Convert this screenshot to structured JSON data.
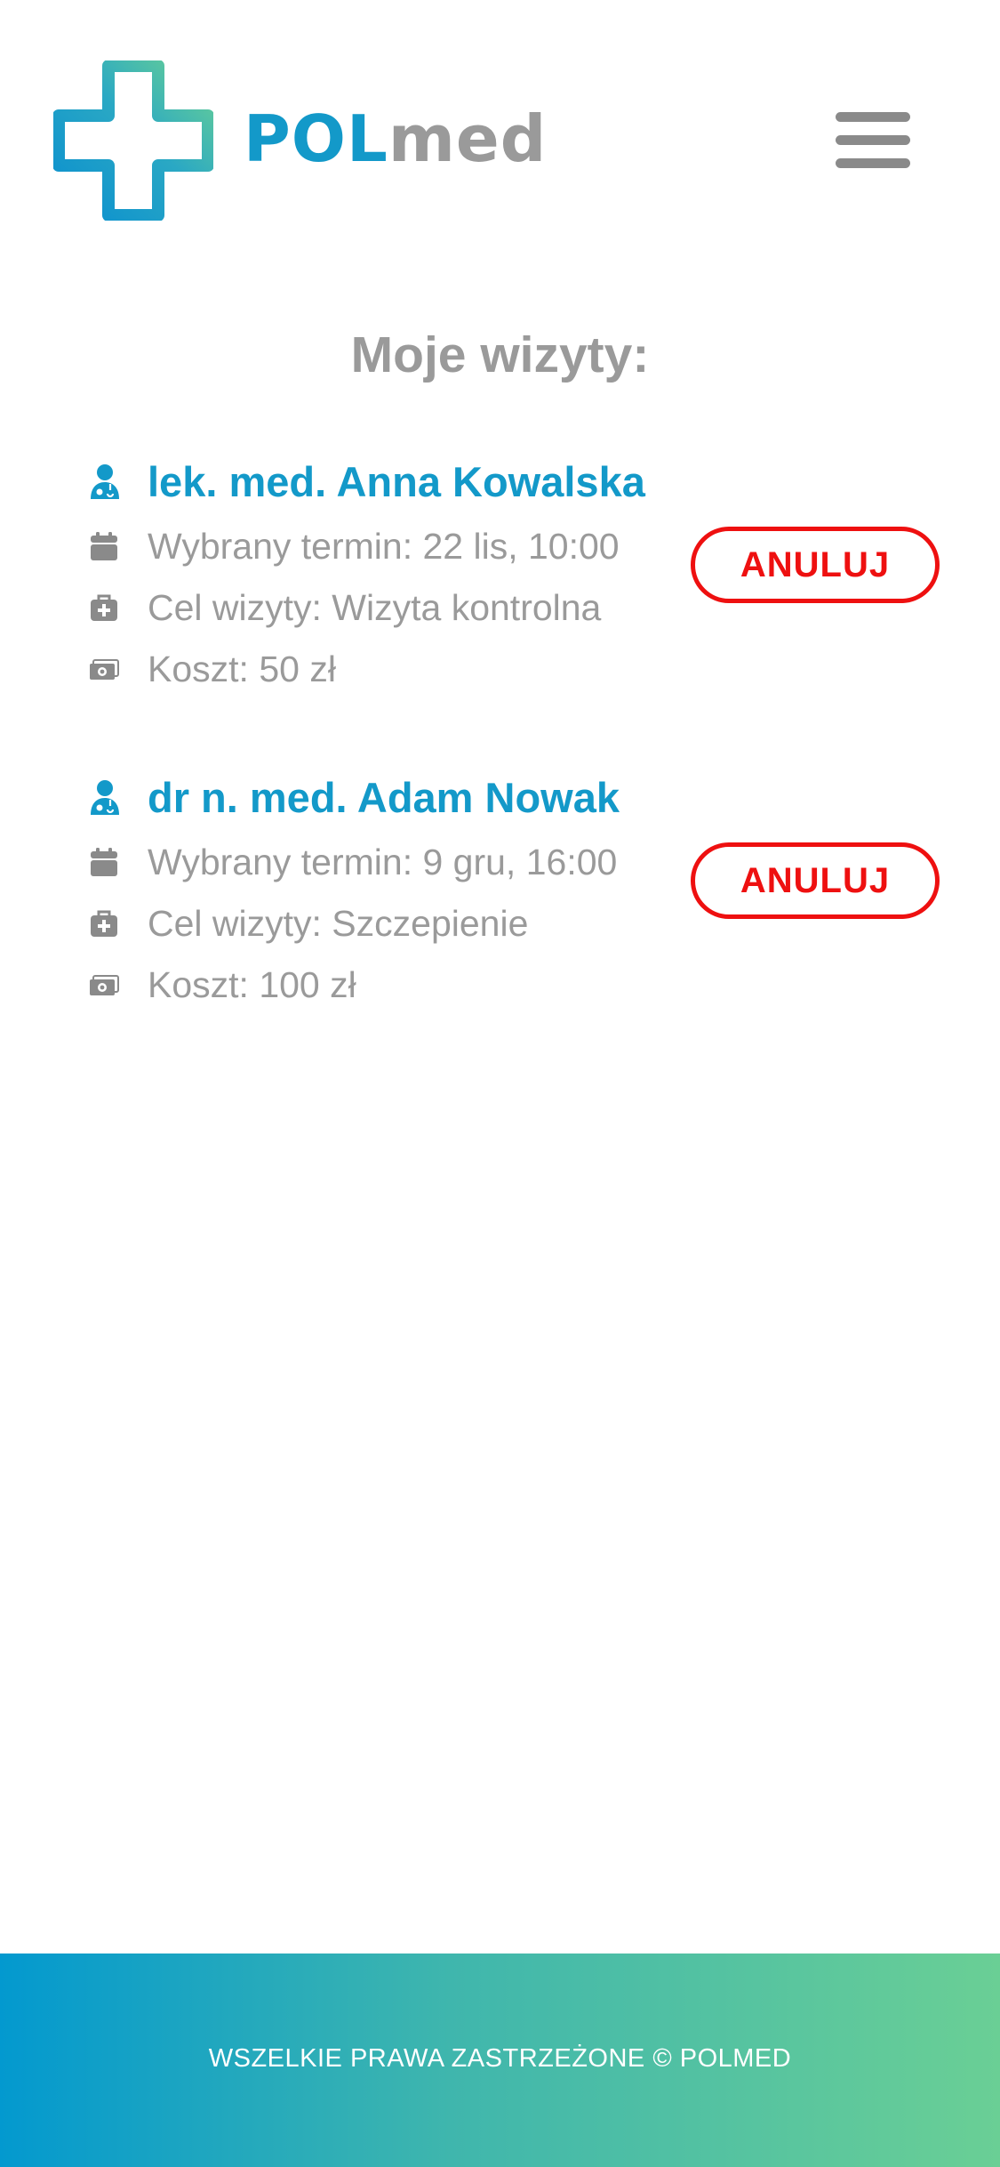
{
  "header": {
    "logo_pol": "POL",
    "logo_med": "med",
    "logo_icon": "medical-cross-logo",
    "menu_icon": "hamburger-menu-icon"
  },
  "page": {
    "title": "Moje wizyty:"
  },
  "visits": [
    {
      "doctor": "lek. med. Anna Kowalska",
      "date": "Wybrany termin: 22 lis, 10:00",
      "purpose": "Cel wizyty: Wizyta kontrolna",
      "cost": "Koszt: 50 zł",
      "cancel_label": "ANULUJ"
    },
    {
      "doctor": "dr n. med. Adam Nowak",
      "date": "Wybrany termin: 9 gru, 16:00",
      "purpose": "Cel wizyty: Szczepienie",
      "cost": "Koszt: 100 zł",
      "cancel_label": "ANULUJ"
    }
  ],
  "footer": {
    "text": "WSZELKIE PRAWA ZASTRZEŻONE © POLMED"
  },
  "colors": {
    "brand_blue": "#1399c9",
    "brand_green": "#6acf95",
    "text_gray": "#9a9a9a",
    "cancel_red": "#ee1010"
  },
  "icons": {
    "doctor": "user-doctor-icon",
    "date": "calendar-icon",
    "purpose": "medical-briefcase-icon",
    "cost": "money-bill-icon"
  }
}
